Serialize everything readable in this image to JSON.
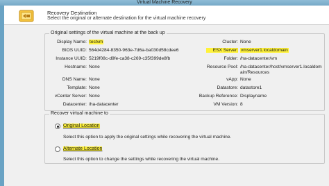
{
  "window_title": "Virtual Machine Recovery",
  "header": {
    "title": "Recovery Destination",
    "subtitle": "Select the original or alternate destination for the virtual machine recovery"
  },
  "original_settings": {
    "legend": "Original settings of the virtual machine at the back up",
    "left": [
      {
        "label": "Display Name:",
        "value": "testvm"
      },
      {
        "label": "BIOS UUID:",
        "value": "564d4284-8350-963e-7d6a-ba030d58cdee6"
      },
      {
        "label": "Instance UUID:",
        "value": "5219f08c-d9fe-ca38-c269-c35f399de8fb"
      },
      {
        "label": "Hostname:",
        "value": "None"
      },
      {
        "label": "DNS Name:",
        "value": "None"
      },
      {
        "label": "Template:",
        "value": "None"
      },
      {
        "label": "vCenter Server:",
        "value": "None"
      },
      {
        "label": "Datacenter:",
        "value": "/ha-datacenter"
      }
    ],
    "right": [
      {
        "label": "Cluster:",
        "value": "None"
      },
      {
        "label": "ESX Server:",
        "value": "vmserver1.localdomain"
      },
      {
        "label": "Folder:",
        "value": "/ha-datacenter/vm"
      },
      {
        "label": "Resource Pool:",
        "value": "/ha-datacenter/host/vmserver1.localdom"
      },
      {
        "label": "",
        "value": "ain/Resources"
      },
      {
        "label": "vApp:",
        "value": "None"
      },
      {
        "label": "Datastore:",
        "value": "datastore1"
      },
      {
        "label": "Backup Reference:",
        "value": "Displayname"
      },
      {
        "label": "VM Version:",
        "value": "8"
      }
    ]
  },
  "recover": {
    "legend": "Recover virtual machine to",
    "original_label": "Original Location",
    "original_desc": "Select this option to apply the original settings while recovering the virtual machine.",
    "alternate_label": "Alternate Location",
    "alternate_desc": "Select this option to change the settings while recovering the virtual machine.",
    "selected": "original"
  },
  "colors": {
    "highlight": "#fff23a",
    "frame": "#6aa3c4"
  }
}
